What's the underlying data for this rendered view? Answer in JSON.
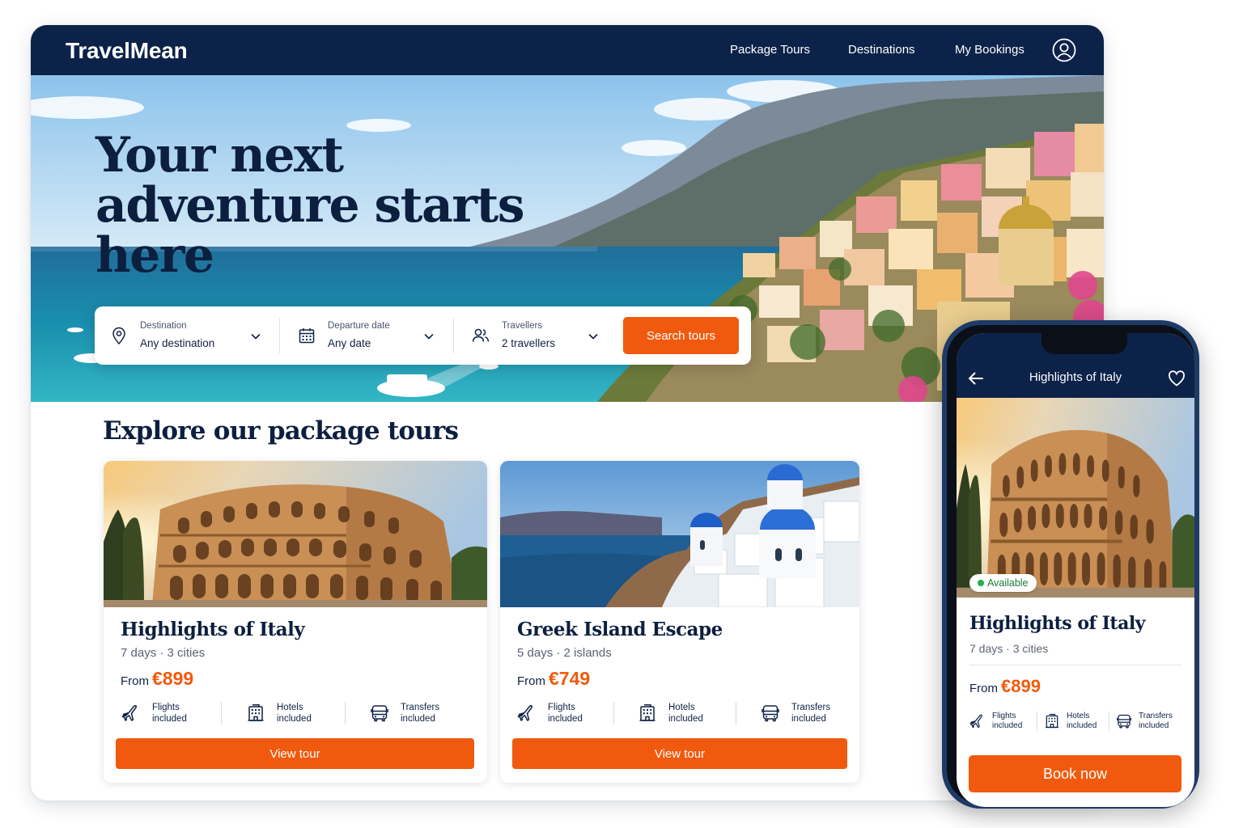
{
  "brand": "TravelMean",
  "nav": {
    "links": [
      "Package Tours",
      "Destinations",
      "My Bookings"
    ],
    "account_icon": "user-circle-icon"
  },
  "hero": {
    "title_line1": "Your next",
    "title_line2": "adventure starts here",
    "image": "amalfi-coast-photo"
  },
  "search": {
    "destination": {
      "label": "Destination",
      "value": "Any destination",
      "icon": "map-pin-icon"
    },
    "date": {
      "label": "Departure date",
      "value": "Any date",
      "icon": "calendar-icon"
    },
    "travellers": {
      "label": "Travellers",
      "value": "2 travellers",
      "icon": "users-icon"
    },
    "button": "Search tours"
  },
  "section_title": "Explore our package tours",
  "tours": [
    {
      "title": "Highlights of Italy",
      "meta": "7 days · 3 cities",
      "price_prefix": "From",
      "price": "€899",
      "image": "colosseum-photo",
      "includes": [
        {
          "l1": "Flights",
          "l2": "included",
          "icon": "plane-icon"
        },
        {
          "l1": "Hotels",
          "l2": "included",
          "icon": "hotel-icon"
        },
        {
          "l1": "Transfers",
          "l2": "included",
          "icon": "bus-icon"
        }
      ],
      "button": "View tour"
    },
    {
      "title": "Greek Island Escape",
      "meta": "5 days · 2 islands",
      "price_prefix": "From",
      "price": "€749",
      "image": "santorini-photo",
      "includes": [
        {
          "l1": "Flights",
          "l2": "included",
          "icon": "plane-icon"
        },
        {
          "l1": "Hotels",
          "l2": "included",
          "icon": "hotel-icon"
        },
        {
          "l1": "Transfers",
          "l2": "included",
          "icon": "bus-icon"
        }
      ],
      "button": "View tour"
    }
  ],
  "mobile": {
    "header_title": "Highlights of Italy",
    "badge": "Available",
    "title": "Highlights of Italy",
    "meta": "7 days · 3 cities",
    "price_prefix": "From",
    "price": "€899",
    "includes": [
      {
        "l1": "Flights",
        "l2": "included",
        "icon": "plane-icon"
      },
      {
        "l1": "Hotels",
        "l2": "included",
        "icon": "hotel-icon"
      },
      {
        "l1": "Transfers",
        "l2": "included",
        "icon": "bus-icon"
      }
    ],
    "button": "Book now"
  },
  "colors": {
    "navy": "#0c2249",
    "accent": "#f15a0e",
    "available_green": "#22b04b"
  }
}
